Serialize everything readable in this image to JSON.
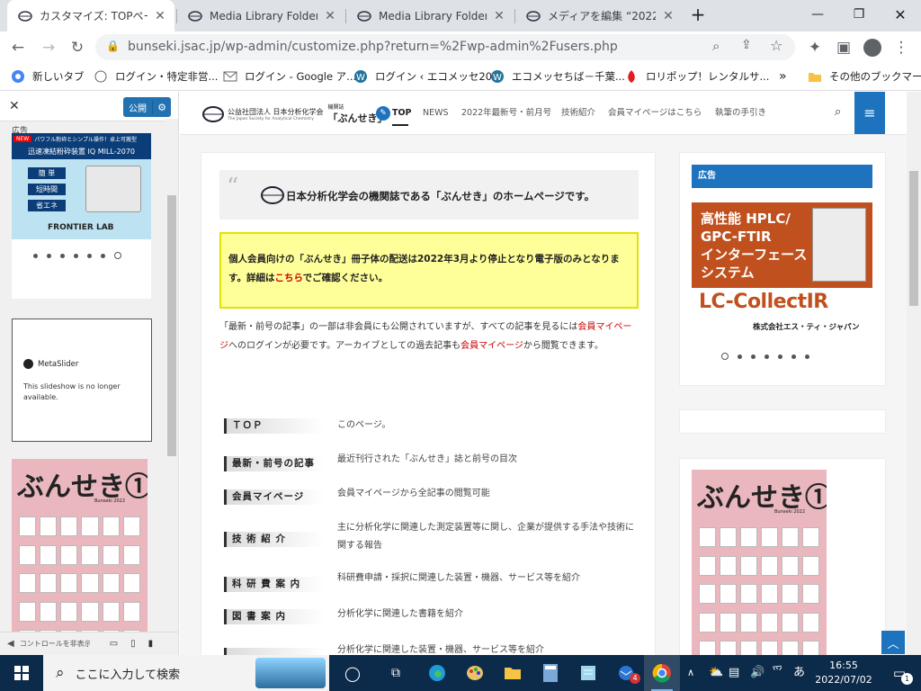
{
  "browser": {
    "tabs": [
      {
        "label": "カスタマイズ: TOPページ",
        "active": true
      },
      {
        "label": "Media Library Folders",
        "active": false
      },
      {
        "label": "Media Library Folders",
        "active": false
      },
      {
        "label": "メディアを編集 “2022ぶん",
        "active": false
      }
    ],
    "new_tab_icon": "plus-icon",
    "url": "bunseki.jsac.jp/wp-admin/customize.php?return=%2Fwp-admin%2Fusers.php",
    "bookmarks": [
      "新しいタブ",
      "ログイン・特定非営...",
      "ログイン - Google ア...",
      "ログイン ‹ エコメッセ20...",
      "エコメッセちば－千葉...",
      "ロリポップ！レンタルサ...",
      "その他のブックマーク"
    ],
    "bookmarks_overflow": "»"
  },
  "customizer": {
    "publish_label": "公開",
    "ad_label": "広告",
    "ad_banner": {
      "badge": "NEW",
      "tagline": "パワフル粉砕とシンプル操作！卓上可搬型",
      "product": "迅速凍結粉砕装置 IQ MILL-2070",
      "features": [
        "簡 単",
        "短時間",
        "省エネ"
      ],
      "brand": "FRONTIER LAB"
    },
    "metaslider_title": "MetaSlider",
    "metaslider_text": "This slideshow is no longer available.",
    "cover_title": "ぶんせき①",
    "cover_sub": "Bunseki 2022",
    "footer_label": "コントロールを非表示"
  },
  "site": {
    "logo_org": "公益社団法人 日本分析化学会",
    "logo_org_en": "The Japan Society for Analytical Chemistry",
    "logo_journal_small": "機関誌",
    "logo_journal": "「ぶんせき」",
    "nav": [
      "TOP",
      "NEWS",
      "2022年最新号・前月号",
      "技術紹介",
      "会員マイページはこちら",
      "執筆の手引き"
    ],
    "quote": "日本分析化学会の機関誌である「ぶんせき」のホームページです。",
    "notice_pre": "個人会員向けの「ぶんせき」冊子体の配送は2022年3月より停止となり電子版のみとなります。詳細は",
    "notice_link": "こちら",
    "notice_post": "でご確認ください。",
    "intro_1": "「最新・前号の記事」の一部は非会員にも公開されていますが、すべての記事を見るには",
    "intro_link1": "会員マイページ",
    "intro_2": "へのログインが必要です。アーカイブとしての過去記事も",
    "intro_link2": "会員マイページ",
    "intro_3": "から閲覧できます。",
    "rows": [
      {
        "label": "ＴＯＰ",
        "desc": "このページ。"
      },
      {
        "label": "最新・前号の記事",
        "desc": "最近刊行された「ぶんせき」誌と前号の目次"
      },
      {
        "label": "会員マイページ",
        "desc": "会員マイページから全記事の閲覧可能"
      },
      {
        "label": "技 術 紹 介",
        "desc": "主に分析化学に関連した測定装置等に関し、企業が提供する手法や技術に関する報告"
      },
      {
        "label": "科 研 費 案 内",
        "desc": "科研費申請・採択に関連した装置・機器、サービス等を紹介"
      },
      {
        "label": "図 書 案 内",
        "desc": "分析化学に関連した書籍を紹介"
      },
      {
        "label": "",
        "desc": "分析化学に関連した装置・機器、サービス等を紹介"
      }
    ],
    "right_ad_title": "広告",
    "right_ad": {
      "line1": "高性能 HPLC/",
      "line2": "GPC-FTIR",
      "line3": "インターフェース",
      "line4": "システム",
      "brand": "LC-CollectIR",
      "company": "株式会社エス・ティ・ジャパン"
    },
    "cover_title": "ぶんせき①",
    "cover_sub": "Bunseki 2022"
  },
  "taskbar": {
    "search_placeholder": "ここに入力して検索",
    "time": "16:55",
    "date": "2022/07/02",
    "ime": "あ",
    "notification_count": "1",
    "mail_badge": "4"
  },
  "colors": {
    "accent": "#1e73be",
    "wp_blue": "#2271b1",
    "link_red": "#cc0000",
    "notice_bg": "#ffff99",
    "taskbar": "#0c2a4a"
  }
}
